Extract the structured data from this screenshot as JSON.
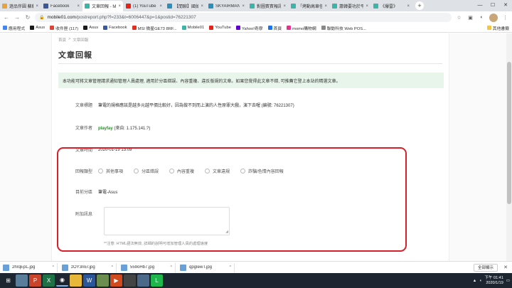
{
  "browser": {
    "tabs": [
      {
        "title": "遊品伴圓 蘇軒上",
        "color": "#e6a23c",
        "active": false
      },
      {
        "title": "Facebook",
        "color": "#3b5998",
        "active": false
      },
      {
        "title": "文章回報 - Mo",
        "color": "#3bb5a8",
        "active": true
      },
      {
        "title": "(1) YouTube",
        "color": "#e62117",
        "active": false
      },
      {
        "title": "【閒聊】國如",
        "color": "#2a8fbd",
        "active": false
      },
      {
        "title": "SKYAIRMAN ...",
        "color": "#2a8fbd",
        "active": false
      },
      {
        "title": "對圖賓賓報訊",
        "color": "#3bb5a8",
        "active": false
      },
      {
        "title": "「烤動高章任",
        "color": "#3bb5a8",
        "active": false
      },
      {
        "title": "蕭韓要功於平",
        "color": "#3bb5a8",
        "active": false
      },
      {
        "title": "《爆雷》",
        "color": "#3bb5a8",
        "active": false
      }
    ],
    "tab_close": "×",
    "new_tab": "+",
    "window_controls": {
      "minimize": "—",
      "maximize": "☐",
      "close": "✕"
    },
    "url_host": "mobile01.com",
    "url_path": "/postreport.php?f=233&t=6006447&p=1&postid=76221307",
    "bookmarks": [
      {
        "label": "應用程式",
        "color": "#4285f4"
      },
      {
        "label": "Asus",
        "color": "#1a1a1a"
      },
      {
        "label": "收件匣 (117)",
        "color": "#db4437"
      },
      {
        "label": "Asus",
        "color": "#1a1a1a"
      },
      {
        "label": "Facebook",
        "color": "#3b5998"
      },
      {
        "label": "MSI 微星GE73 8RF...",
        "color": "#e0301e"
      },
      {
        "label": "Mobile01",
        "color": "#3bb5a8"
      },
      {
        "label": "YouTube",
        "color": "#e62117"
      },
      {
        "label": "Yahoo!奇摩",
        "color": "#6001d2"
      },
      {
        "label": "首頁",
        "color": "#1a73e8"
      },
      {
        "label": "momo購物網",
        "color": "#e8318c"
      },
      {
        "label": "聯動科技 Web POS...",
        "color": "#888888"
      }
    ],
    "other_bookmarks": "其他書籤"
  },
  "page": {
    "breadcrumb": [
      "首頁",
      ">",
      "文章回報"
    ],
    "title": "文章回報",
    "notice": "本功能可將文章管理請求通知管理人員處理, 適用於分區錯誤、內容重複、違反版規的文章。如果您覺得此文章不錯, 可推薦它登上本站的精選文章。",
    "fields": {
      "subject_label": "文章標題",
      "subject_value": "筆電的規格應該是越多元越平價比較好，因為做不到而上演的人性原罪大戲，演下去喔 (編號: 76221307)",
      "author_label": "文章作者",
      "author_name": "playfay",
      "author_ip": " (來自: 1.175.141.?)",
      "time_label": "文章時間",
      "time_value": "2020-01-19 13:09",
      "type_label": "回報類型",
      "type_options": [
        "其他事項",
        "分區錯誤",
        "內容重複",
        "文章違規",
        "詐騙/色情內容回報"
      ],
      "forum_label": "目前分區",
      "forum_value": "筆電-Asus",
      "message_label": "附加訊息"
    },
    "hint": "**注意: HTML語法無效, 詳細的說明可增加管理人員的處理速度"
  },
  "downloads": {
    "items": [
      "2hrqEpL.jpg",
      "zOY3nEr.jpg",
      "559oHb7.jpg",
      "qpgIewT.jpg"
    ],
    "show_all": "全部顯示",
    "close": "✕"
  },
  "taskbar": {
    "clock_time": "下午 01:41",
    "clock_date": "2020/1/19"
  }
}
